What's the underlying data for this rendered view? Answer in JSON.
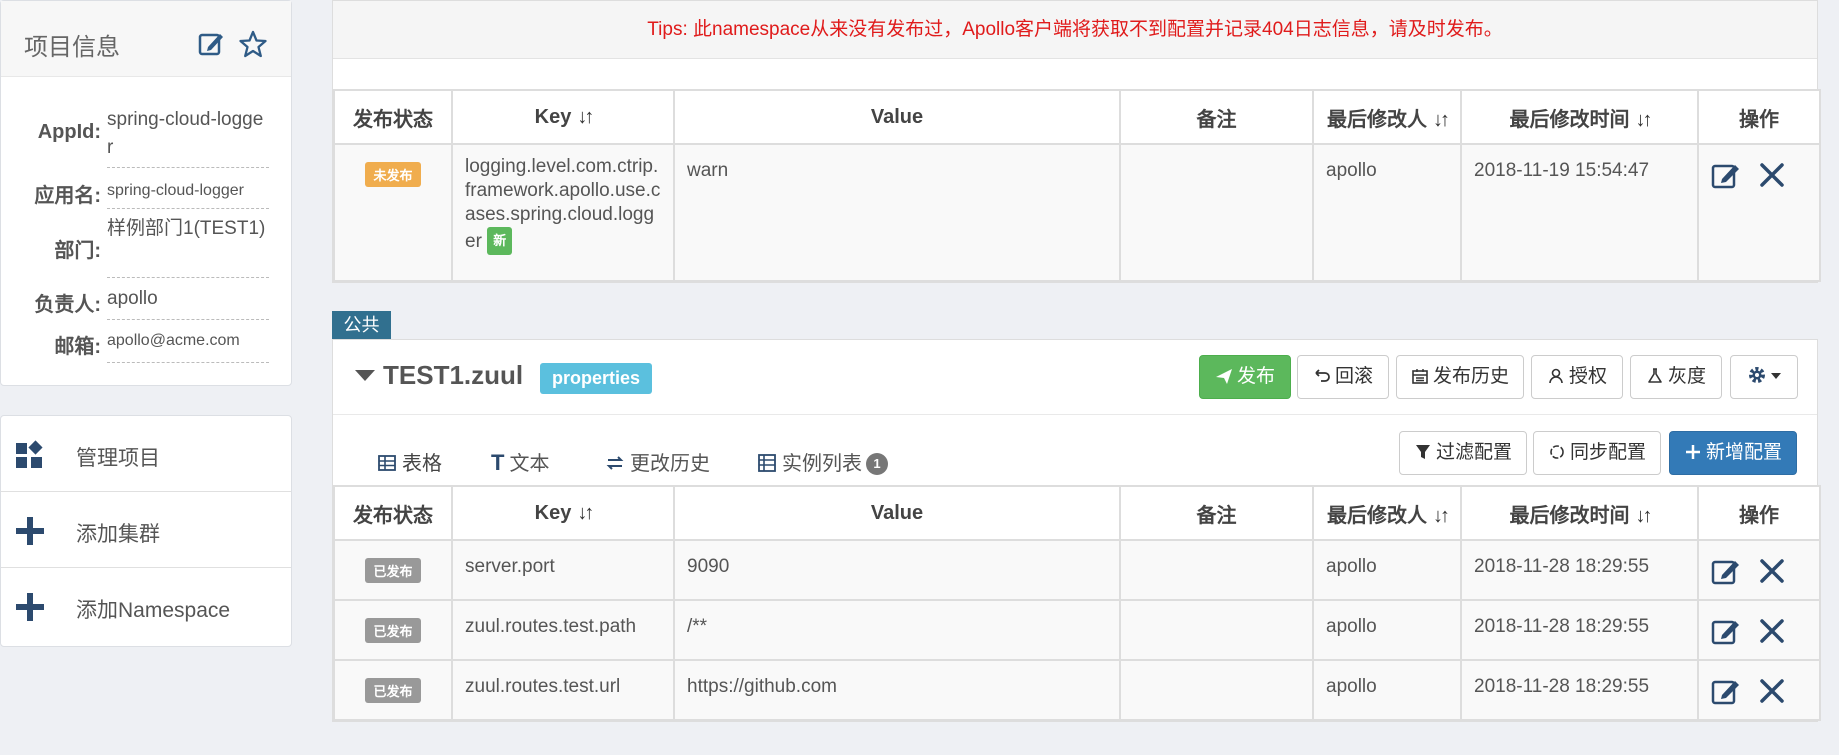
{
  "project_info": {
    "title": "项目信息",
    "fields": [
      {
        "label": "AppId:",
        "value": "spring-cloud-logger"
      },
      {
        "label": "应用名:",
        "value": "spring-cloud-logger"
      },
      {
        "label": "部门:",
        "value": "样例部门1(TEST1)"
      },
      {
        "label": "负责人:",
        "value": "apollo"
      },
      {
        "label": "邮箱:",
        "value": "apollo@acme.com"
      }
    ]
  },
  "nav": [
    {
      "label": "管理项目",
      "icon": "apps-icon"
    },
    {
      "label": "添加集群",
      "icon": "plus-icon"
    },
    {
      "label": "添加Namespace",
      "icon": "plus-icon"
    }
  ],
  "top": {
    "tips": "Tips: 此namespace从来没有发布过，Apollo客户端将获取不到配置并记录404日志信息，请及时发布。",
    "headers": [
      "发布状态",
      "Key",
      "Value",
      "备注",
      "最后修改人",
      "最后修改时间",
      "操作"
    ],
    "rows": [
      {
        "status": "未发布",
        "key": "logging.level.com.ctrip.framework.apollo.use.cases.spring.cloud.logger",
        "new_badge": "新",
        "value": "warn",
        "comment": "",
        "modifier": "apollo",
        "time": "2018-11-19 15:54:47"
      }
    ]
  },
  "namespace": {
    "tag": "公共",
    "name": "TEST1.zuul",
    "format": "properties",
    "buttons": {
      "publish": "发布",
      "rollback": "回滚",
      "history": "发布历史",
      "auth": "授权",
      "gray": "灰度"
    },
    "tabs": {
      "table": "表格",
      "text": "文本",
      "changes": "更改历史",
      "instances": "实例列表",
      "instances_count": "1"
    },
    "actions": {
      "filter": "过滤配置",
      "sync": "同步配置",
      "add": "新增配置"
    },
    "headers": [
      "发布状态",
      "Key",
      "Value",
      "备注",
      "最后修改人",
      "最后修改时间",
      "操作"
    ],
    "rows": [
      {
        "status": "已发布",
        "key": "server.port",
        "value": "9090",
        "comment": "",
        "modifier": "apollo",
        "time": "2018-11-28 18:29:55"
      },
      {
        "status": "已发布",
        "key": "zuul.routes.test.path",
        "value": "/**",
        "comment": "",
        "modifier": "apollo",
        "time": "2018-11-28 18:29:55"
      },
      {
        "status": "已发布",
        "key": "zuul.routes.test.url",
        "value": "https://github.com",
        "comment": "",
        "modifier": "apollo",
        "time": "2018-11-28 18:29:55"
      }
    ]
  },
  "colors": {
    "accent": "#337ab7",
    "success": "#5cb85c",
    "warning": "#f0ad4e",
    "danger_text": "#e01b1b",
    "tag": "#31708f"
  }
}
